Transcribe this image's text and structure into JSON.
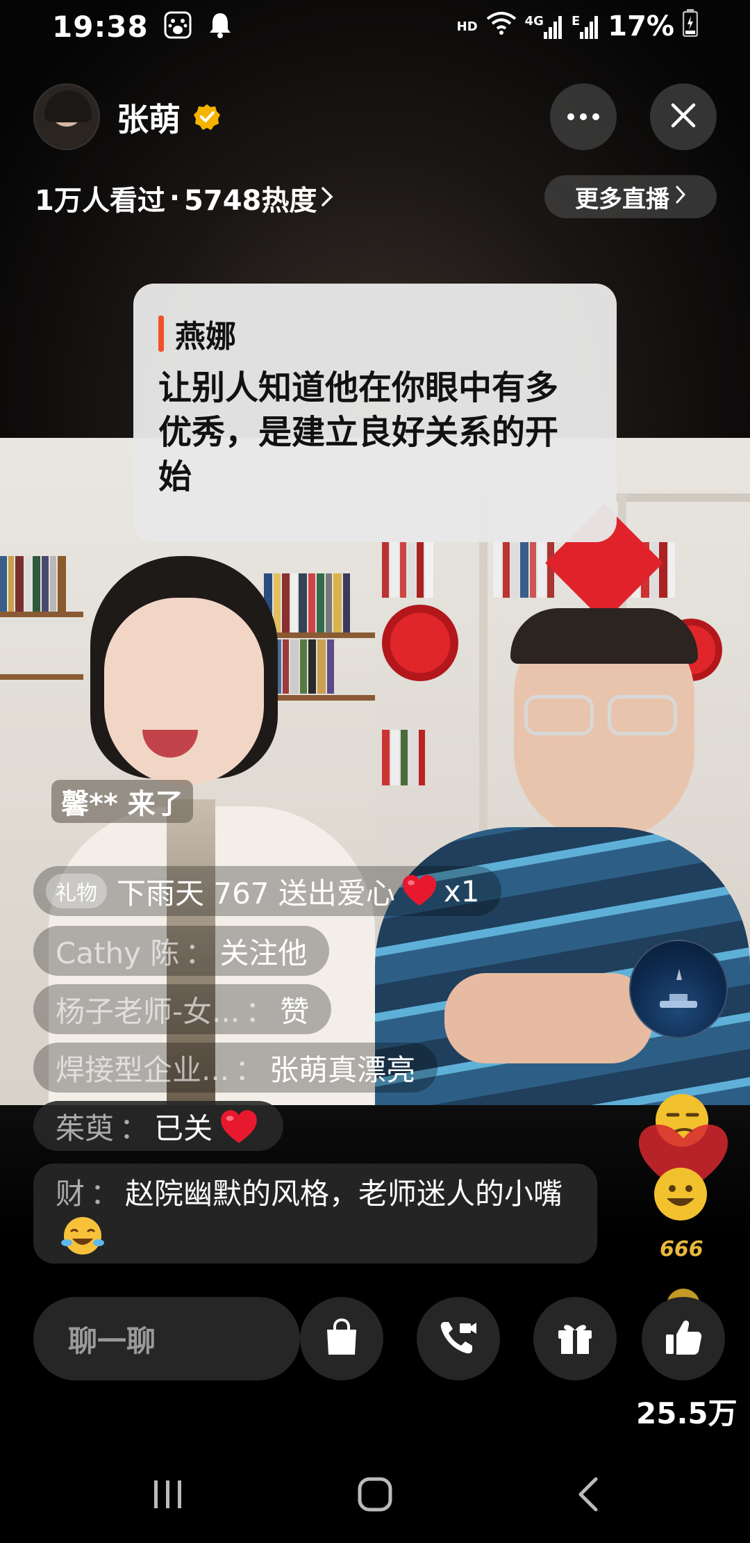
{
  "status_bar": {
    "time": "19:38",
    "battery": "17%",
    "hd_label": "HD",
    "net_label": "4G",
    "e_label": "E"
  },
  "header": {
    "streamer_name": "张萌",
    "viewers": "1万人看过",
    "dot": "·",
    "heat": "5748热度",
    "more_live": "更多直播"
  },
  "quote": {
    "author": "燕娜",
    "text": "让别人知道他在你眼中有多优秀，是建立良好关系的开始"
  },
  "chat": {
    "join_notice": "馨** 来了",
    "gift": {
      "tag": "礼物",
      "text": "下雨天 767 送出爱心",
      "count": "x1"
    },
    "messages": [
      {
        "name": "Cathy 陈",
        "sep": "：",
        "text": "关注他"
      },
      {
        "name": "杨子老师-女...",
        "sep": "：",
        "text": "赞"
      },
      {
        "name": "焊接型企业...",
        "sep": "：",
        "text": "张萌真漂亮"
      },
      {
        "name": "茱萸",
        "sep": "：",
        "text": "已关"
      },
      {
        "name": "财",
        "sep": "：",
        "text": "赵院幽默的风格，老师迷人的小嘴"
      }
    ]
  },
  "bottom_bar": {
    "input_placeholder": "聊一聊",
    "like_count": "25.5万"
  },
  "floating": {
    "label_666": "666"
  },
  "colors": {
    "accent": "#f0522a",
    "verified": "#f5b400",
    "heart": "#e8182f"
  }
}
